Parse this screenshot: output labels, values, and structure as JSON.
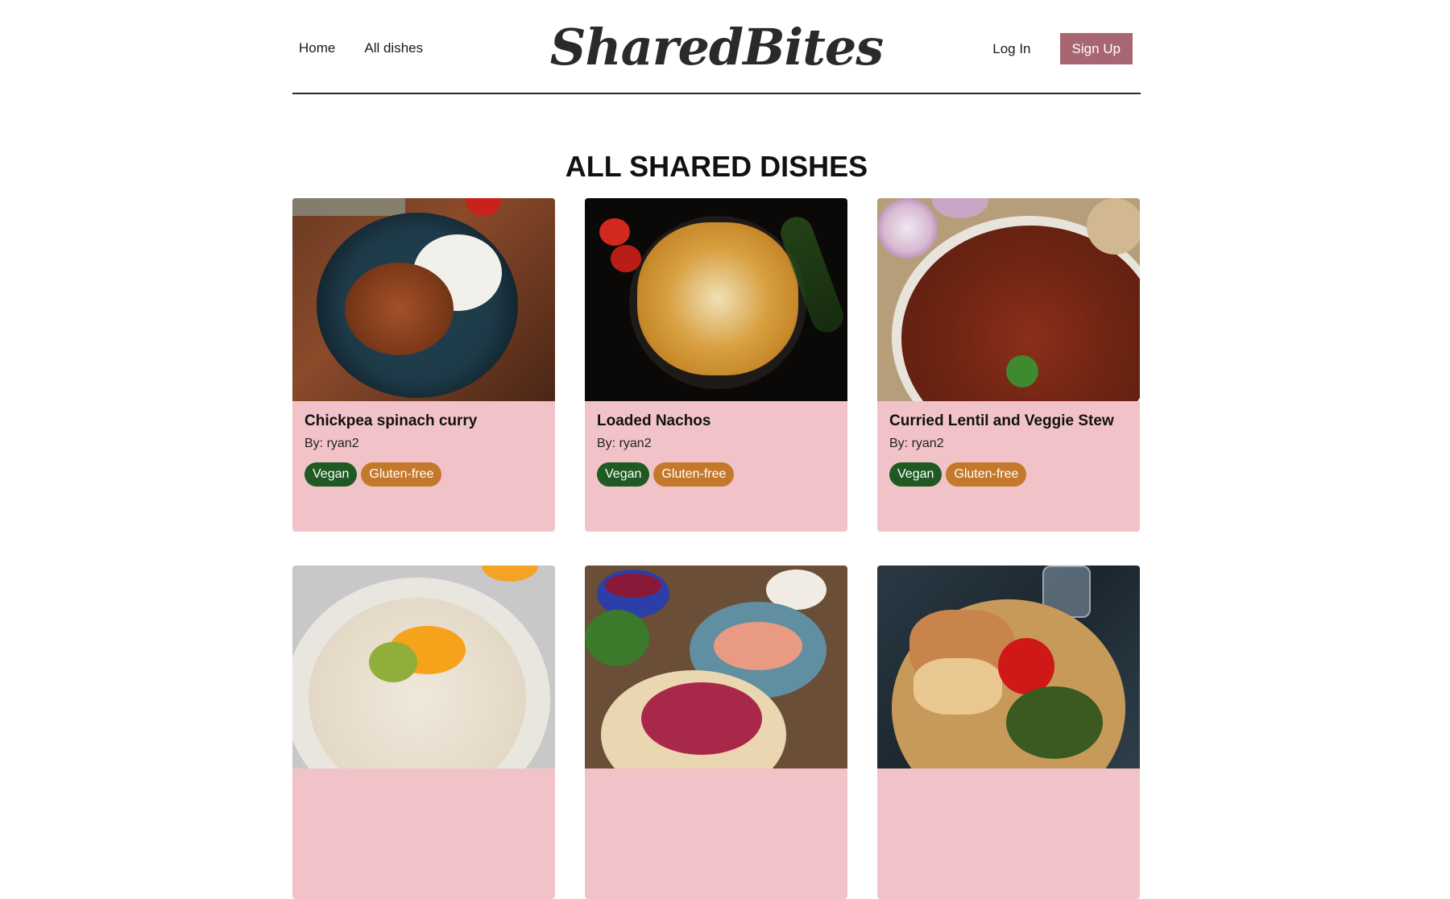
{
  "nav": {
    "home": "Home",
    "all_dishes": "All dishes",
    "logo": "SharedBites",
    "login": "Log In",
    "signup": "Sign Up"
  },
  "page": {
    "title": "ALL SHARED DISHES"
  },
  "colors": {
    "card_bg": "#f1c3c8",
    "signup_bg": "#a86673",
    "vegan_tag": "#1f5a23",
    "gluten_free_tag": "#c4782b"
  },
  "dishes": [
    {
      "title": "Chickpea spinach curry",
      "author": "By: ryan2",
      "tags": [
        "Vegan",
        "Gluten-free"
      ]
    },
    {
      "title": "Loaded Nachos",
      "author": "By: ryan2",
      "tags": [
        "Vegan",
        "Gluten-free"
      ]
    },
    {
      "title": "Curried Lentil and Veggie Stew",
      "author": "By: ryan2",
      "tags": [
        "Vegan",
        "Gluten-free"
      ]
    },
    {
      "title": "",
      "author": "",
      "tags": []
    },
    {
      "title": "",
      "author": "",
      "tags": []
    },
    {
      "title": "",
      "author": "",
      "tags": []
    }
  ]
}
